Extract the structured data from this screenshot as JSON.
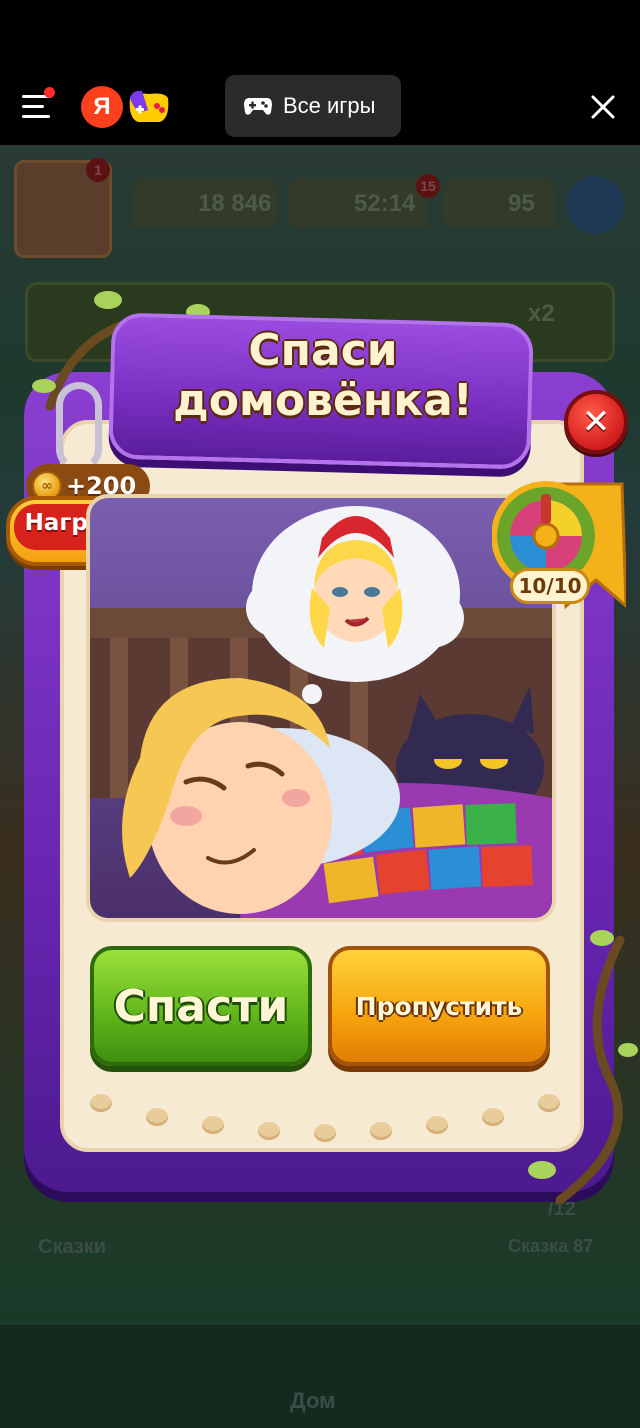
{
  "topbar": {
    "all_games_label": "Все игры",
    "yandex_letter": "Я"
  },
  "background_game": {
    "hud": {
      "profile_badge": "1",
      "coins": "18 846",
      "lives_timer": "52:14",
      "lives_badge": "15",
      "stars": "95"
    },
    "offer_badge": "x2",
    "bottom_labels": {
      "fairy_tales": "Сказки",
      "tale_progress": "/12",
      "tale_name": "Сказка 87",
      "home": "Дом"
    }
  },
  "modal": {
    "title_line1": "Спаси",
    "title_line2": "домовёнка!",
    "reward_label": "Награда",
    "reward_amount": "+200",
    "roulette_count": "10/10",
    "save_button": "Спасти",
    "skip_button": "Пропустить"
  },
  "colors": {
    "modal_purple": "#7b30c4",
    "save_green": "#5fb41a",
    "skip_orange": "#f6a20c",
    "close_red": "#d21d1d"
  },
  "icons": [
    "menu-icon",
    "yandex-logo",
    "yandex-games-logo",
    "gamepad-icon",
    "close-icon",
    "coin-icon",
    "roulette-icon"
  ]
}
